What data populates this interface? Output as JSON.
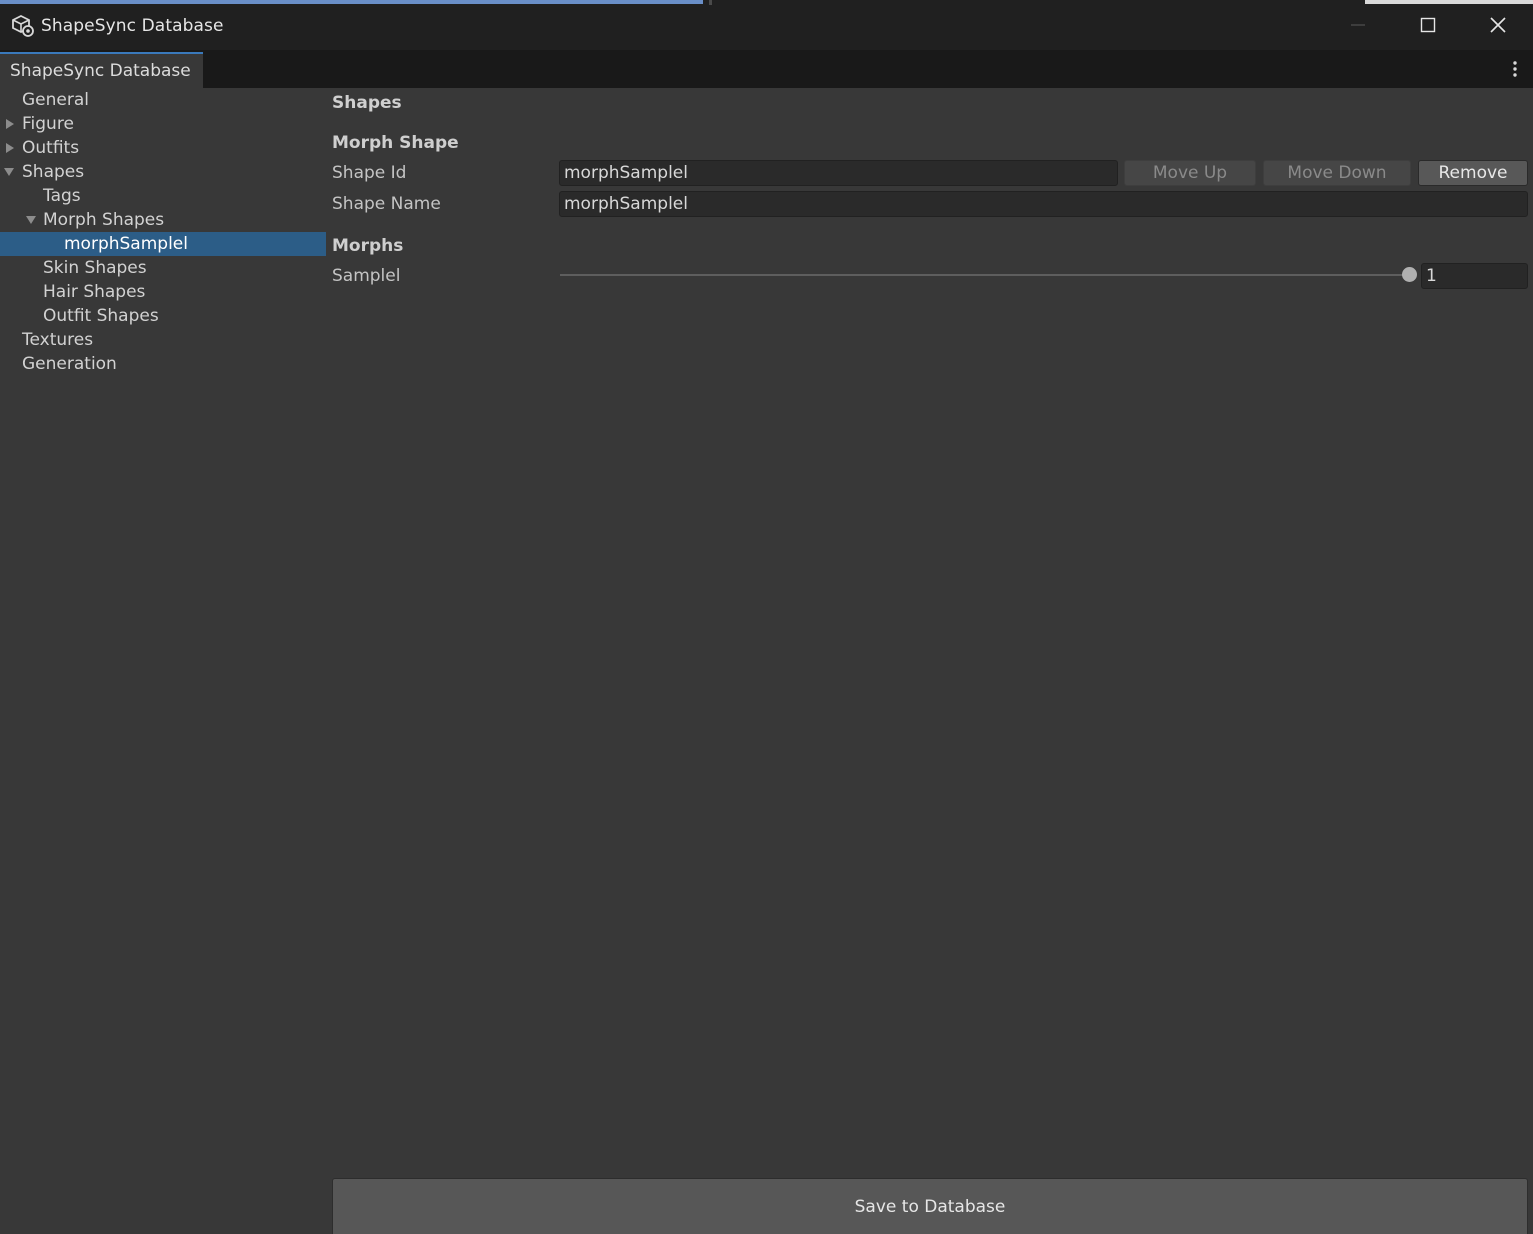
{
  "window": {
    "title": "ShapeSync Database",
    "controls": {
      "minimize": "minimize-icon",
      "maximize": "maximize-icon",
      "close": "close-icon"
    }
  },
  "tabs": [
    {
      "label": "ShapeSync Database",
      "active": true
    }
  ],
  "sidebar": {
    "items": [
      {
        "label": "General",
        "expandable": false
      },
      {
        "label": "Figure",
        "expandable": true,
        "expanded": false
      },
      {
        "label": "Outfits",
        "expandable": true,
        "expanded": false
      },
      {
        "label": "Shapes",
        "expandable": true,
        "expanded": true
      },
      {
        "label": "Tags",
        "expandable": false
      },
      {
        "label": "Morph Shapes",
        "expandable": true,
        "expanded": true
      },
      {
        "label": "morphSamplel",
        "expandable": false,
        "selected": true
      },
      {
        "label": "Skin Shapes",
        "expandable": false
      },
      {
        "label": "Hair Shapes",
        "expandable": false
      },
      {
        "label": "Outfit Shapes",
        "expandable": false
      },
      {
        "label": "Textures",
        "expandable": false
      },
      {
        "label": "Generation",
        "expandable": false
      }
    ]
  },
  "main": {
    "header": "Shapes",
    "morph_shape": {
      "title": "Morph Shape",
      "shape_id_label": "Shape Id",
      "shape_id_value": "morphSamplel",
      "shape_name_label": "Shape Name",
      "shape_name_value": "morphSamplel",
      "move_up_label": "Move Up",
      "move_down_label": "Move Down",
      "remove_label": "Remove"
    },
    "morphs": {
      "title": "Morphs",
      "items": [
        {
          "label": "Samplel",
          "value": "1",
          "slider_fraction": 1.0
        }
      ]
    },
    "save_label": "Save to Database"
  },
  "colors": {
    "selection": "#2c5d87",
    "tab_accent": "#3a79bb",
    "background": "#383838",
    "titlebar": "#202020"
  }
}
